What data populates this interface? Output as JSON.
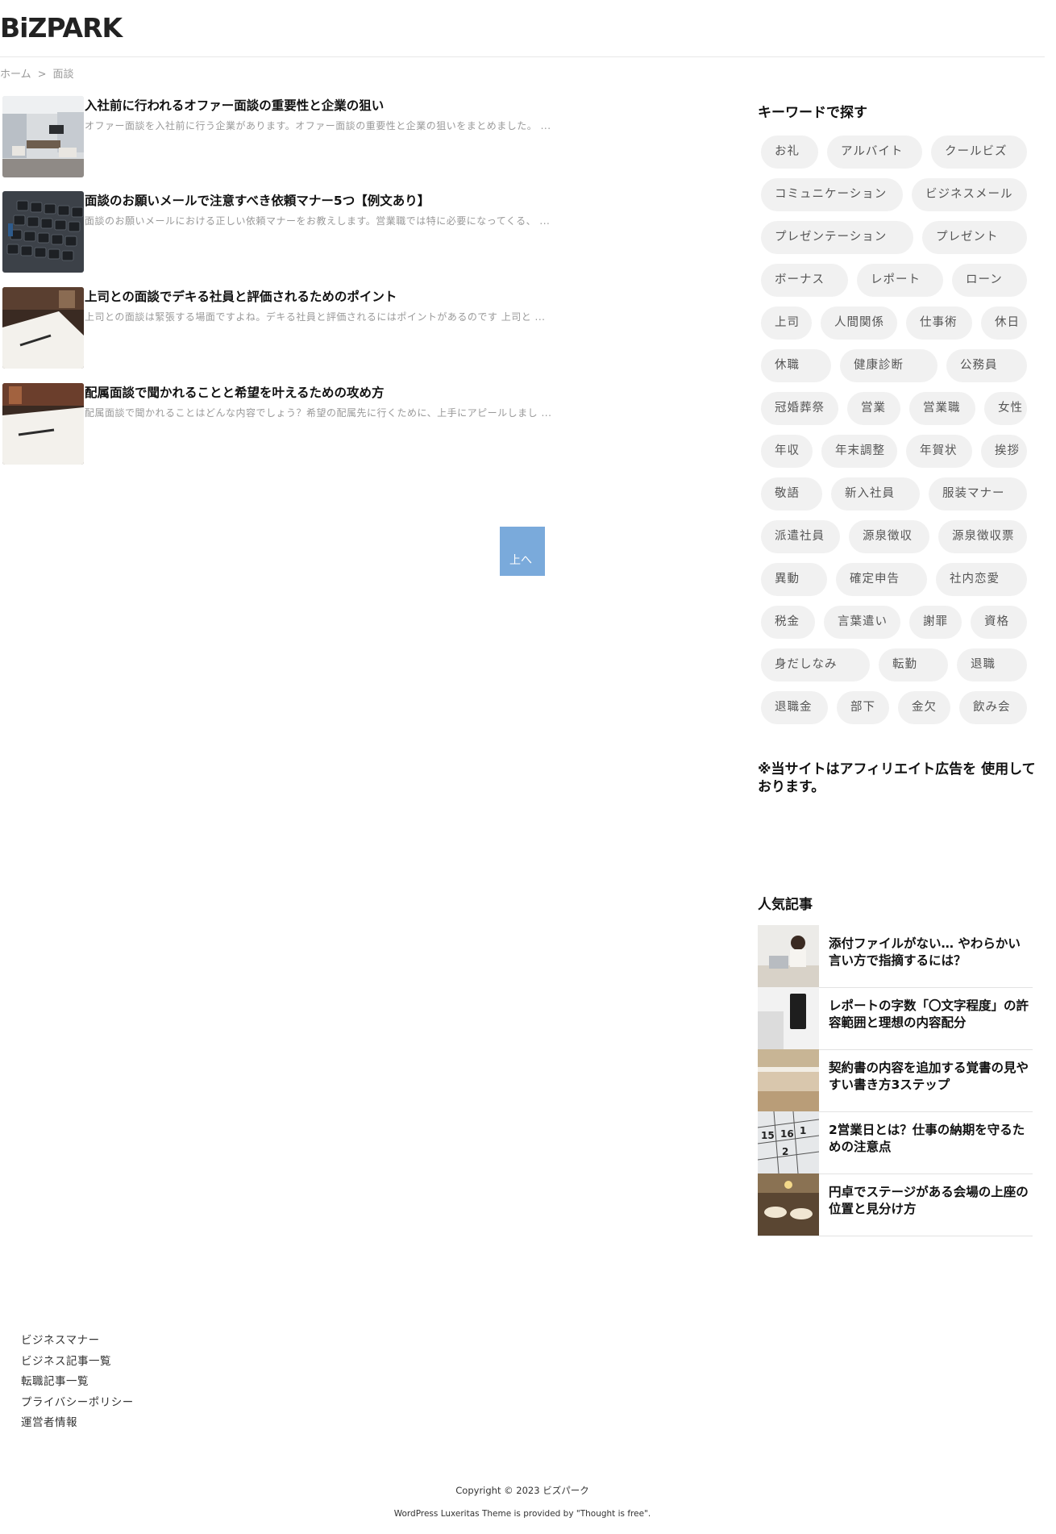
{
  "header": {
    "logo": "BiZPARK"
  },
  "breadcrumb": {
    "home": "ホーム",
    "separator": ">",
    "current": "面談"
  },
  "posts": [
    {
      "title": "入社前に行われるオファー面談の重要性と企業の狙い",
      "excerpt": "オファー面談を入社前に行う企業があります。オファー面談の重要性と企業の狙いをまとめました。 ...",
      "thumb": "office-room"
    },
    {
      "title": "面談のお願いメールで注意すべき依頼マナー5つ【例文あり】",
      "excerpt": "面談のお願いメールにおける正しい依頼マナーをお教えします。営業職では特に必要になってくる、 ...",
      "thumb": "keyboard"
    },
    {
      "title": "上司との面談でデキる社員と評価されるためのポイント",
      "excerpt": "上司との面談は緊張する場面ですよね。デキる社員と評価されるにはポイントがあるのです 上司と ...",
      "thumb": "notebook-pen"
    },
    {
      "title": "配属面談で聞かれることと希望を叶えるための攻め方",
      "excerpt": "配属面談で聞かれることはどんな内容でしょう？希望の配属先に行くために、上手にアピールしまし ...",
      "thumb": "notebook-pen"
    }
  ],
  "to_top": {
    "label": "上へ"
  },
  "sidebar": {
    "keyword_title": "キーワードで探す",
    "tags": [
      [
        "お礼",
        "アルバイト",
        "クールビズ"
      ],
      [
        "コミュニケーション",
        "ビジネスメール"
      ],
      [
        "プレゼンテーション",
        "プレゼント"
      ],
      [
        "ボーナス",
        "レポート",
        "ローン"
      ],
      [
        "上司",
        "人間関係",
        "仕事術",
        "休日"
      ],
      [
        "休職",
        "健康診断",
        "公務員"
      ],
      [
        "冠婚葬祭",
        "営業",
        "営業職",
        "女性"
      ],
      [
        "年収",
        "年末調整",
        "年賀状",
        "挨拶"
      ],
      [
        "敬語",
        "新入社員",
        "服装マナー"
      ],
      [
        "派遣社員",
        "源泉徴収",
        "源泉徴収票"
      ],
      [
        "異動",
        "確定申告",
        "社内恋愛"
      ],
      [
        "税金",
        "言葉遣い",
        "謝罪",
        "資格"
      ],
      [
        "身だしなみ",
        "転勤",
        "退職"
      ],
      [
        "退職金",
        "部下",
        "金欠",
        "飲み会"
      ]
    ],
    "affiliate_notice": "※当サイトはアフィリエイト広告を 使用しております。",
    "popular_title": "人気記事",
    "popular": [
      {
        "title": "添付ファイルがない… やわらかい言い方で指摘するには？",
        "thumb": "woman-laptop"
      },
      {
        "title": "レポートの字数「〇文字程度」の許容範囲と理想の内容配分",
        "thumb": "keyboard-notebook"
      },
      {
        "title": "契約書の内容を追加する覚書の見やすい書き方3ステップ",
        "thumb": "desk-wood"
      },
      {
        "title": "2営業日とは？仕事の納期を守るための注意点",
        "thumb": "calendar"
      },
      {
        "title": "円卓でステージがある会場の上座の位置と見分け方",
        "thumb": "banquet-hall"
      }
    ]
  },
  "footer": {
    "links": [
      "ビジネスマナー",
      "ビジネス記事一覧",
      "転職記事一覧",
      "プライバシーポリシー",
      "運営者情報"
    ],
    "copyright": "Copyright © 2023 ビズパーク",
    "credit": "WordPress Luxeritas Theme is provided by \"Thought is free\"."
  }
}
